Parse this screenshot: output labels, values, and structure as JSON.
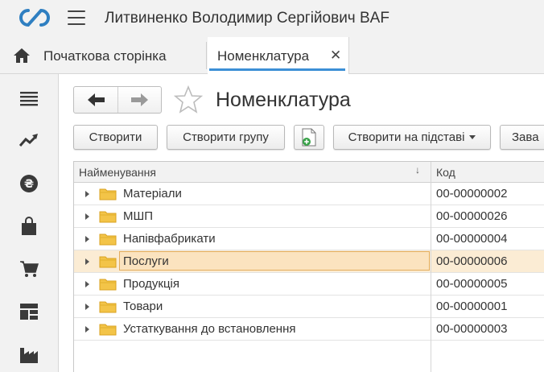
{
  "app": {
    "title": "Литвиненко Володимир Сергійович BAF"
  },
  "tabs": {
    "home_label": "Початкова сторінка",
    "active_label": "Номенклатура",
    "close_glyph": "✕"
  },
  "sidebar": {
    "items": [
      {
        "icon": "menu-list-icon"
      },
      {
        "icon": "trend-chart-icon"
      },
      {
        "icon": "money-icon"
      },
      {
        "icon": "shopping-bag-icon"
      },
      {
        "icon": "shopping-cart-icon"
      },
      {
        "icon": "grid-tiles-icon"
      },
      {
        "icon": "factory-icon"
      }
    ]
  },
  "page": {
    "title": "Номенклатура"
  },
  "toolbar": {
    "create_label": "Створити",
    "create_group_label": "Створити групу",
    "create_based_label": "Створити на підставі",
    "more_label": "Зава"
  },
  "table": {
    "columns": {
      "name": "Найменування",
      "code": "Код",
      "sort_glyph": "↓"
    },
    "rows": [
      {
        "name": "Матеріали",
        "code": "00-00000002",
        "selected": false
      },
      {
        "name": "МШП",
        "code": "00-00000026",
        "selected": false
      },
      {
        "name": "Напівфабрикати",
        "code": "00-00000004",
        "selected": false
      },
      {
        "name": "Послуги",
        "code": "00-00000006",
        "selected": true
      },
      {
        "name": "Продукція",
        "code": "00-00000005",
        "selected": false
      },
      {
        "name": "Товари",
        "code": "00-00000001",
        "selected": false
      },
      {
        "name": "Устаткування до встановлення",
        "code": "00-00000003",
        "selected": false
      }
    ]
  },
  "colors": {
    "accent": "#3c8fd6",
    "logo": "#2f7fc1",
    "folder": "#f3c448",
    "selected_row": "#fbecd4"
  }
}
